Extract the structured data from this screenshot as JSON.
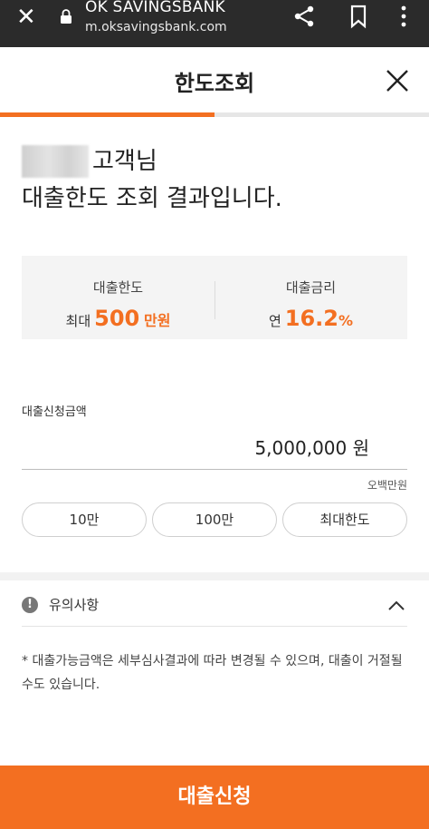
{
  "browser": {
    "site_title": "OK SAVINGSBANK",
    "url": "m.oksavingsbank.com"
  },
  "header": {
    "title": "한도조회",
    "progress_fraction": 0.5
  },
  "greeting": {
    "suffix": "고객님",
    "line2": "대출한도 조회 결과입니다."
  },
  "summary": {
    "limit_label": "대출한도",
    "limit_prefix": "최대",
    "limit_value": "500",
    "limit_unit": "만원",
    "rate_label": "대출금리",
    "rate_prefix": "연",
    "rate_value": "16.2",
    "rate_unit": "%"
  },
  "amount": {
    "label": "대출신청금액",
    "value": "5,000,000 원",
    "korean_text": "오백만원",
    "quick_buttons": [
      "10만",
      "100만",
      "최대한도"
    ]
  },
  "notice": {
    "title": "유의사항",
    "body": "* 대출가능금액은 세부심사결과에 따라 변경될 수 있으며, 대출이 거절될 수도 있습니다."
  },
  "apply_label": "대출신청",
  "colors": {
    "accent": "#f36f21",
    "browser_bar": "#2b2b2b"
  }
}
